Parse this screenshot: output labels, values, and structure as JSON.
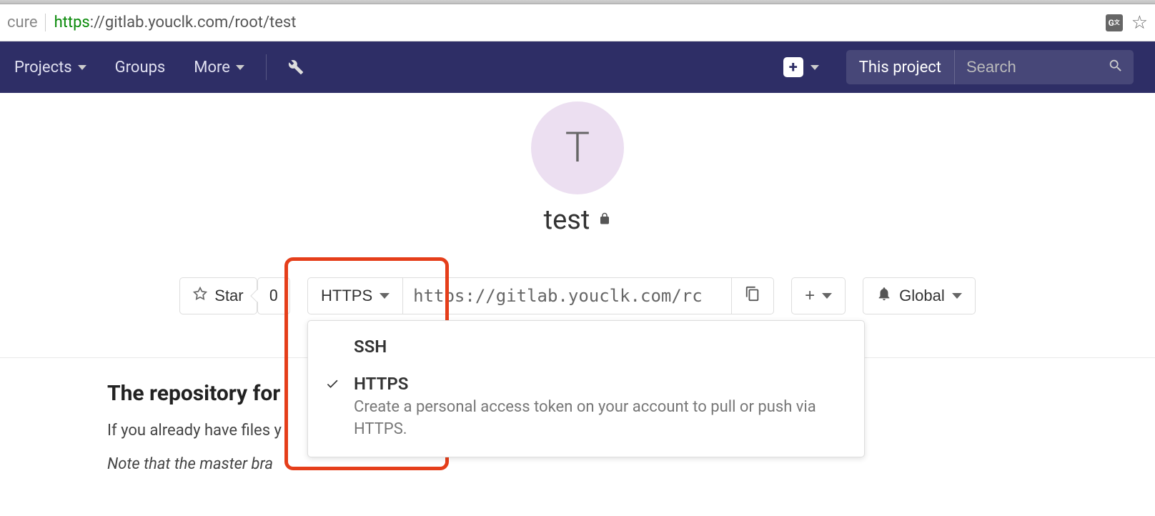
{
  "browser": {
    "secure_label": "cure",
    "url_green": "https",
    "url_rest": "://gitlab.youclk.com/root/test"
  },
  "nav": {
    "projects": "Projects",
    "groups": "Groups",
    "more": "More",
    "search_scope": "This project",
    "search_placeholder": "Search"
  },
  "project": {
    "avatar_letter": "T",
    "name": "test"
  },
  "actions": {
    "star": "Star",
    "star_count": "0",
    "protocol": "HTTPS",
    "clone_url": "https://gitlab.youclk.com/rc",
    "global": "Global"
  },
  "protocol_dropdown": {
    "ssh": "SSH",
    "https": "HTTPS",
    "https_desc": "Create a personal access token on your account to pull or push via HTTPS."
  },
  "repo": {
    "heading": "The repository for",
    "sub": "If you already have files y",
    "note": "Note that the master bra"
  }
}
